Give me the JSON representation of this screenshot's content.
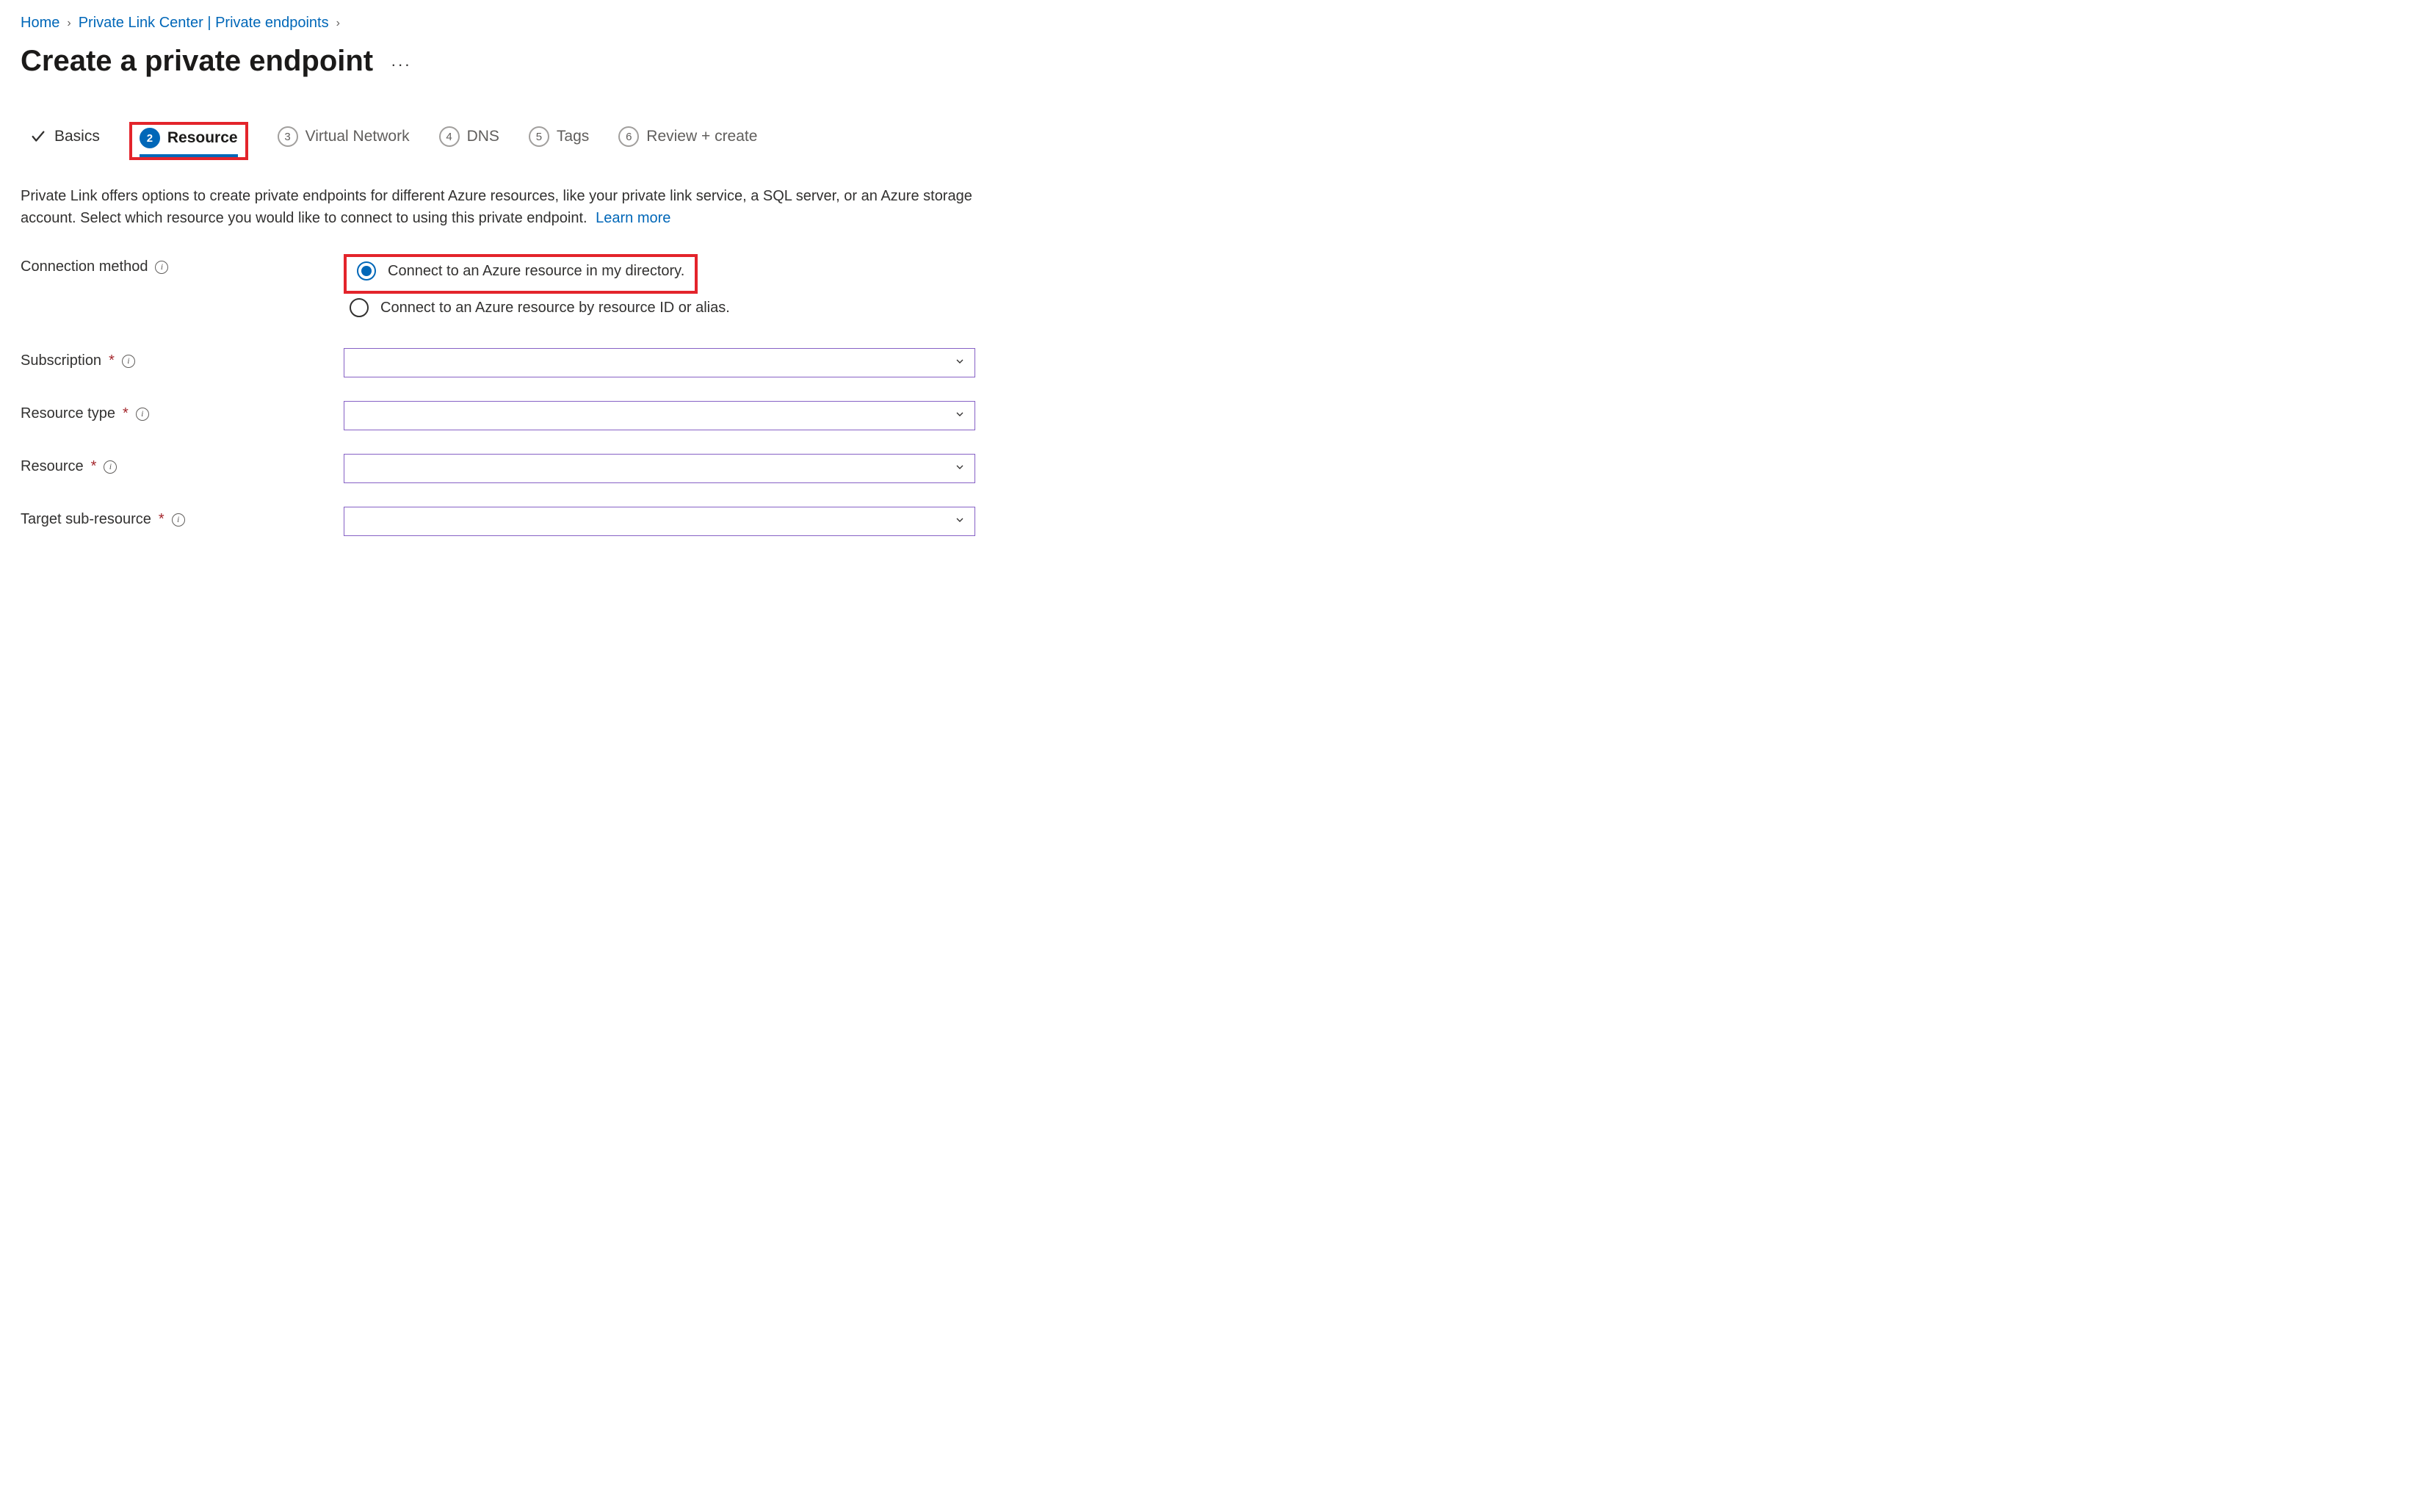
{
  "breadcrumb": {
    "home": "Home",
    "center": "Private Link Center | Private endpoints"
  },
  "title": "Create a private endpoint",
  "tabs": {
    "basics": "Basics",
    "resource_num": "2",
    "resource": "Resource",
    "vnet_num": "3",
    "vnet": "Virtual Network",
    "dns_num": "4",
    "dns": "DNS",
    "tags_num": "5",
    "tags": "Tags",
    "review_num": "6",
    "review": "Review + create"
  },
  "description_text": "Private Link offers options to create private endpoints for different Azure resources, like your private link service, a SQL server, or an Azure storage account. Select which resource you would like to connect to using this private endpoint.",
  "learn_more": "Learn more",
  "labels": {
    "connection_method": "Connection method",
    "subscription": "Subscription",
    "resource_type": "Resource type",
    "resource": "Resource",
    "target_sub": "Target sub-resource"
  },
  "radios": {
    "opt1": "Connect to an Azure resource in my directory.",
    "opt2": "Connect to an Azure resource by resource ID or alias."
  },
  "dropdowns": {
    "subscription": "",
    "resource_type": "",
    "resource": "",
    "target_sub": ""
  }
}
